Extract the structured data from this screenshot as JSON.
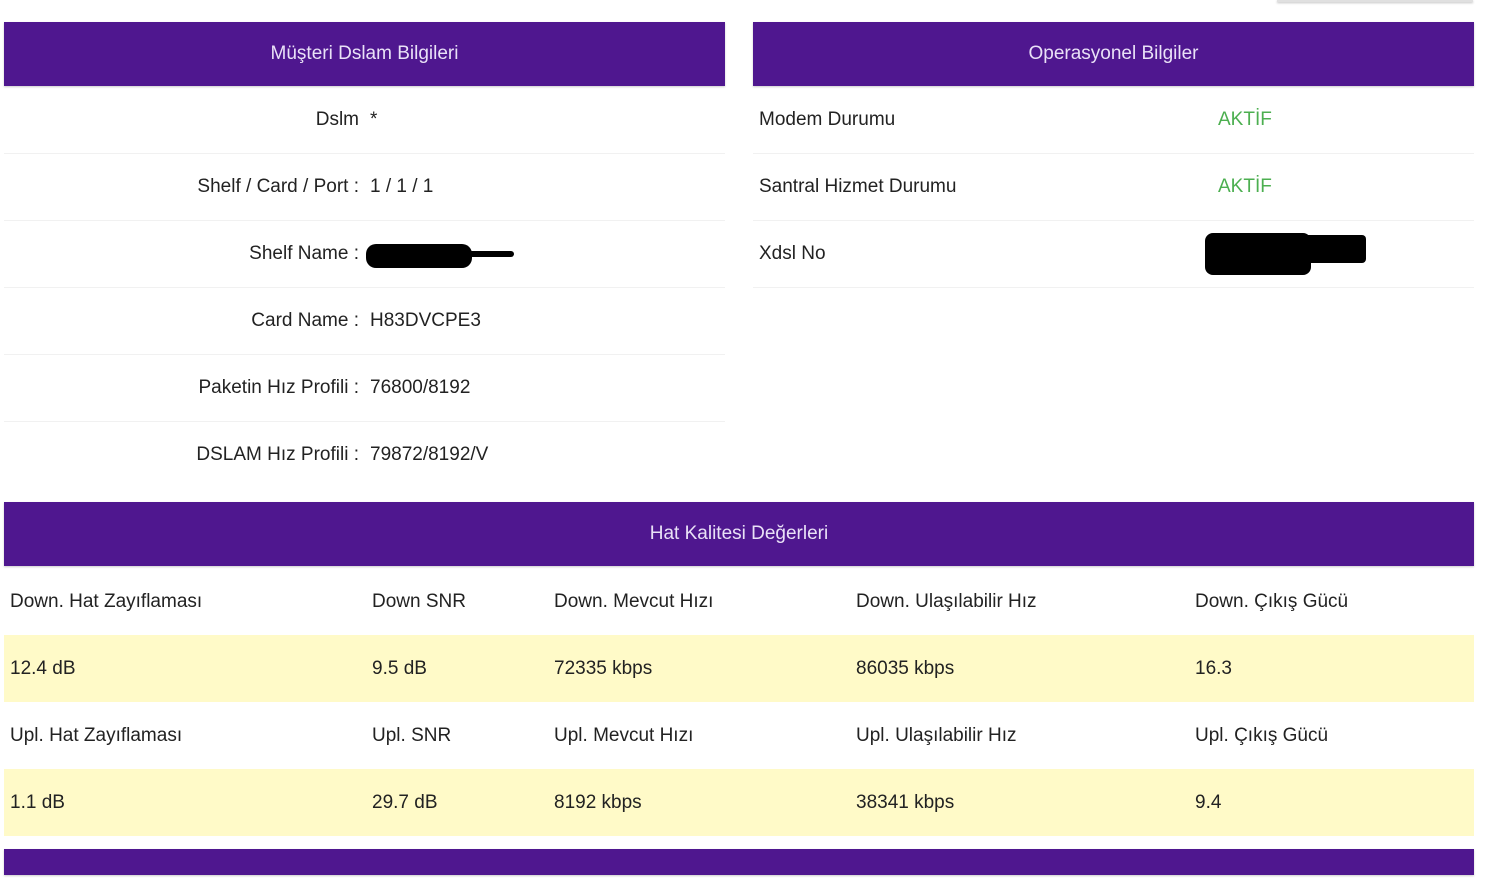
{
  "colors": {
    "header_bg": "#4f178f",
    "status_active": "#4caf50",
    "value_row_bg": "#fffac8"
  },
  "customer_dslam": {
    "title": "Müşteri Dslam Bilgileri",
    "rows": [
      {
        "label": "Dslm",
        "value": "*"
      },
      {
        "label": "Shelf / Card / Port :",
        "value": "1 / 1 / 1"
      },
      {
        "label": "Shelf Name :",
        "value": ""
      },
      {
        "label": "Card Name :",
        "value": "H83DVCPE3"
      },
      {
        "label": "Paketin Hız Profili :",
        "value": "76800/8192"
      },
      {
        "label": "DSLAM Hız Profili :",
        "value": "79872/8192/V"
      }
    ]
  },
  "operational": {
    "title": "Operasyonel Bilgiler",
    "rows": [
      {
        "label": "Modem Durumu",
        "value": "AKTİF"
      },
      {
        "label": "Santral Hizmet Durumu",
        "value": "AKTİF"
      },
      {
        "label": "Xdsl No",
        "value": ""
      }
    ]
  },
  "line_quality": {
    "title": "Hat Kalitesi Değerleri",
    "down_headers": [
      "Down. Hat Zayıflaması",
      "Down SNR",
      "Down. Mevcut Hızı",
      "Down. Ulaşılabilir Hız",
      "Down. Çıkış Gücü"
    ],
    "down_values": [
      "12.4 dB",
      "9.5 dB",
      "72335 kbps",
      "86035 kbps",
      "16.3"
    ],
    "up_headers": [
      "Upl. Hat Zayıflaması",
      "Upl. SNR",
      "Upl. Mevcut Hızı",
      "Upl. Ulaşılabilir Hız",
      "Upl. Çıkış Gücü"
    ],
    "up_values": [
      "1.1 dB",
      "29.7 dB",
      "8192 kbps",
      "38341 kbps",
      "9.4"
    ]
  },
  "bottom_panel": {
    "title": ""
  }
}
